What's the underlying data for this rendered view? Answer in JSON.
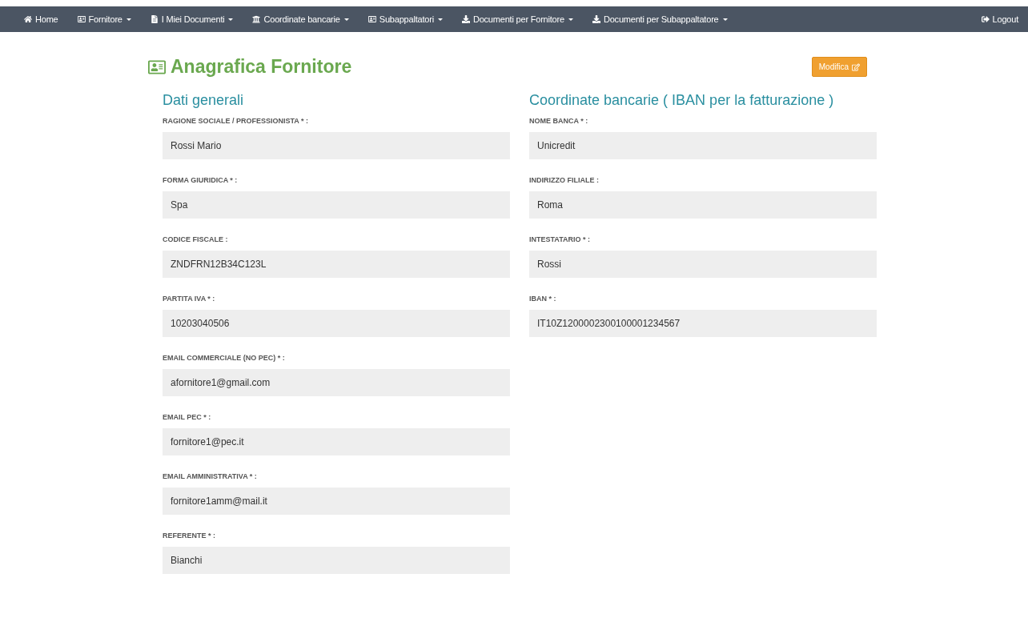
{
  "navbar": {
    "items": [
      {
        "label": "Home",
        "kind": "home",
        "dropdown": false
      },
      {
        "label": "Fornitore",
        "kind": "card",
        "dropdown": true
      },
      {
        "label": "I Miei Documenti",
        "kind": "file",
        "dropdown": true
      },
      {
        "label": "Coordinate bancarie",
        "kind": "bank",
        "dropdown": true
      },
      {
        "label": "Subappaltatori",
        "kind": "card",
        "dropdown": true
      },
      {
        "label": "Documenti per Fornitore",
        "kind": "download",
        "dropdown": true
      },
      {
        "label": "Documenti per Subappaltatore",
        "kind": "download",
        "dropdown": true
      }
    ],
    "logout": {
      "label": "Logout"
    }
  },
  "page": {
    "title": "Anagrafica Fornitore",
    "edit_button": "Modifica"
  },
  "sections": [
    {
      "title": "Dati generali",
      "fields": [
        {
          "label": "RAGIONE SOCIALE / PROFESSIONISTA * :",
          "value": "Rossi Mario"
        },
        {
          "label": "FORMA GIURIDICA * :",
          "value": "Spa"
        },
        {
          "label": "CODICE FISCALE :",
          "value": "ZNDFRN12B34C123L"
        },
        {
          "label": "PARTITA IVA * :",
          "value": "10203040506"
        },
        {
          "label": "EMAIL COMMERCIALE (NO PEC) * :",
          "value": "afornitore1@gmail.com"
        },
        {
          "label": "EMAIL PEC * :",
          "value": "fornitore1@pec.it"
        },
        {
          "label": "EMAIL AMMINISTRATIVA * :",
          "value": "fornitore1amm@mail.it"
        },
        {
          "label": "REFERENTE * :",
          "value": "Bianchi"
        }
      ]
    },
    {
      "title": "Coordinate bancarie ( IBAN per la fatturazione )",
      "fields": [
        {
          "label": "NOME BANCA * :",
          "value": "Unicredit"
        },
        {
          "label": "INDIRIZZO FILIALE :",
          "value": "Roma"
        },
        {
          "label": "INTESTATARIO * :",
          "value": "Rossi"
        },
        {
          "label": "IBAN * :",
          "value": "IT10Z1200002300100001234567"
        }
      ]
    }
  ]
}
